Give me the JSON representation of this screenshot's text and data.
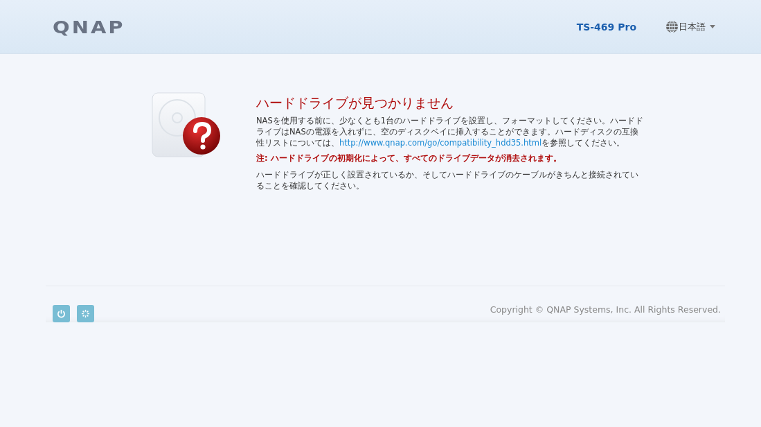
{
  "header": {
    "logo": "QNAP",
    "model": "TS-469 Pro",
    "language": "日本語"
  },
  "message": {
    "title": "ハードドライブが見つかりません",
    "paragraph_1": {
      "before": "NASを使用する前に、少なくとも1台のハードドライブを設置し、フォーマットしてください。ハードドライブはNASの電源を入れずに、空のディスクベイに挿入することができます。ハードディスクの互換性リストについては、",
      "link": "http://www.qnap.com/go/compatibility_hdd35.html",
      "after": "を参照してください。"
    },
    "note": "注: ハードドライブの初期化によって、すべてのドライブデータが消去されます。",
    "paragraph_2": "ハードドライブが正しく設置されているか、そしてハードドライブのケーブルがきちんと接続されていることを確認してください。"
  },
  "footer": {
    "buttons": [
      {
        "kind": "power"
      },
      {
        "kind": "restart"
      }
    ],
    "copyright": "Copyright © QNAP Systems, Inc. All Rights Reserved."
  }
}
